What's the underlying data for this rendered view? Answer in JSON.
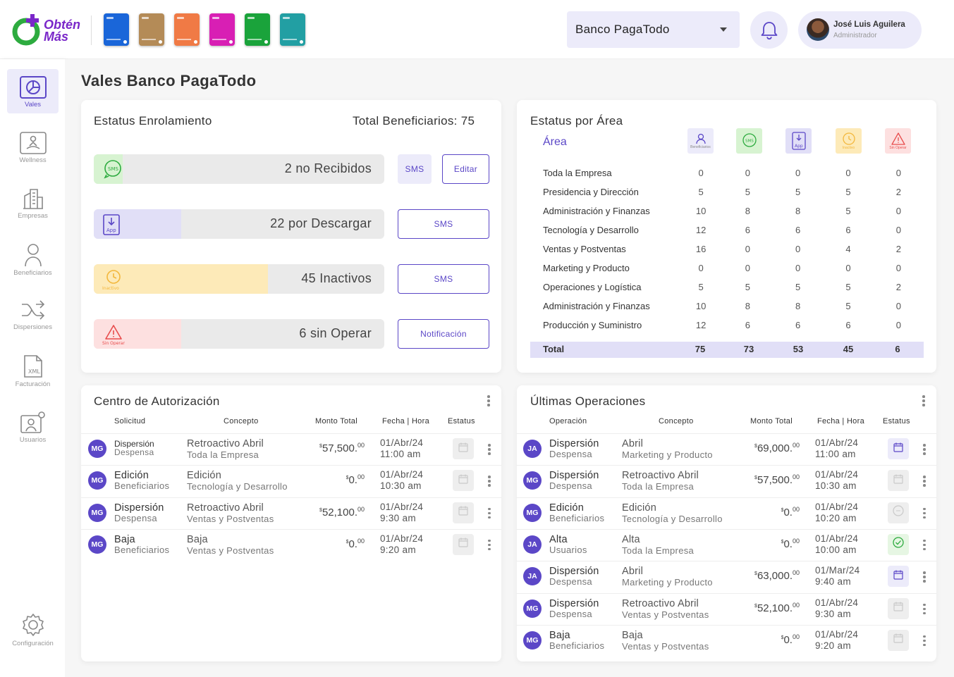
{
  "brand": {
    "line1": "Obtén",
    "line2": "Más"
  },
  "cards": [
    {
      "color": "#1a66d9"
    },
    {
      "color": "#b48b57"
    },
    {
      "color": "#f07a45"
    },
    {
      "color": "#d81fb4"
    },
    {
      "color": "#1aa33b"
    },
    {
      "color": "#229fa3"
    }
  ],
  "company_select": {
    "value": "Banco PagaTodo"
  },
  "user": {
    "name": "José Luis Aguilera",
    "role": "Administrador"
  },
  "sidebar": [
    {
      "label": "Vales",
      "icon": "pie-chart-icon"
    },
    {
      "label": "Wellness",
      "icon": "meditation-icon"
    },
    {
      "label": "Empresas",
      "icon": "building-icon"
    },
    {
      "label": "Beneficiarios",
      "icon": "person-icon"
    },
    {
      "label": "Dispersiones",
      "icon": "shuffle-icon"
    },
    {
      "label": "Facturación",
      "icon": "xml-file-icon"
    },
    {
      "label": "Usuarios",
      "icon": "user-gear-icon"
    },
    {
      "label": "Configuración",
      "icon": "gear-icon"
    }
  ],
  "page_title": "Vales Banco PagaTodo",
  "enrollment": {
    "title": "Estatus Enrolamiento",
    "total_label": "Total Beneficiarios: 75",
    "items": [
      {
        "text": "2 no Recibidos",
        "icon_label": "SMS",
        "progress": 0.1,
        "color": "#d7f3d1",
        "actions": [
          "SMS",
          "Editar"
        ]
      },
      {
        "text": "22 por Descargar",
        "icon_label": "App",
        "progress": 0.3,
        "color": "#e1dff7",
        "actions": [
          "SMS"
        ]
      },
      {
        "text": "45 Inactivos",
        "icon_label": "Inactivo",
        "progress": 0.6,
        "color": "#fdeab8",
        "actions": [
          "SMS"
        ]
      },
      {
        "text": "6 sin Operar",
        "icon_label": "Sin Operar",
        "progress": 0.3,
        "color": "#fde0e0",
        "actions": [
          "Notificación"
        ]
      }
    ]
  },
  "area_status": {
    "title": "Estatus por Área",
    "area_label": "Área",
    "columns": [
      {
        "label": "Beneficiarios",
        "color": "#ecebfa"
      },
      {
        "label": "SMS",
        "color": "#d7f3d1"
      },
      {
        "label": "App",
        "color": "#e1dff7"
      },
      {
        "label": "Inactivo",
        "color": "#fdeab8"
      },
      {
        "label": "Sin Operar",
        "color": "#fde0e0"
      }
    ],
    "rows": [
      {
        "area": "Toda la Empresa",
        "values": [
          "0",
          "0",
          "0",
          "0",
          "0"
        ]
      },
      {
        "area": "Presidencia y Dirección",
        "values": [
          "5",
          "5",
          "5",
          "5",
          "2"
        ]
      },
      {
        "area": "Administración y Finanzas",
        "values": [
          "10",
          "8",
          "8",
          "5",
          "0"
        ]
      },
      {
        "area": "Tecnología y Desarrollo",
        "values": [
          "12",
          "6",
          "6",
          "6",
          "0"
        ]
      },
      {
        "area": "Ventas y Postventas",
        "values": [
          "16",
          "0",
          "0",
          "4",
          "2"
        ]
      },
      {
        "area": "Marketing y Producto",
        "values": [
          "0",
          "0",
          "0",
          "0",
          "0"
        ]
      },
      {
        "area": "Operaciones y Logística",
        "values": [
          "5",
          "5",
          "5",
          "5",
          "2"
        ]
      },
      {
        "area": "Administración y Finanzas",
        "values": [
          "10",
          "8",
          "8",
          "5",
          "0"
        ]
      },
      {
        "area": "Producción y Suministro",
        "values": [
          "12",
          "6",
          "6",
          "6",
          "0"
        ]
      }
    ],
    "total": {
      "label": "Total",
      "values": [
        "75",
        "73",
        "53",
        "45",
        "6"
      ]
    }
  },
  "authorization": {
    "title": "Centro de Autorización",
    "headers": [
      "Solicitud",
      "Concepto",
      "Monto Total",
      "Fecha | Hora",
      "Estatus"
    ],
    "rows": [
      {
        "initials": "MG",
        "type": "Dispersión",
        "sub": "Despensa",
        "concept": "Retroactivo Abril",
        "area": "Toda la Empresa",
        "currency": "$",
        "amount": "57,500.",
        "cents": "00",
        "date": "01/Abr/24",
        "time": "11:00 am",
        "status": "calendar-icon",
        "small": true
      },
      {
        "initials": "MG",
        "type": "Edición",
        "sub": "Beneficiarios",
        "concept": "Edición",
        "area": "Tecnología y Desarrollo",
        "currency": "$",
        "amount": "0.",
        "cents": "00",
        "date": "01/Abr/24",
        "time": "10:30 am",
        "status": "calendar-icon"
      },
      {
        "initials": "MG",
        "type": "Dispersión",
        "sub": "Despensa",
        "concept": "Retroactivo Abril",
        "area": "Ventas y Postventas",
        "currency": "$",
        "amount": "52,100.",
        "cents": "00",
        "date": "01/Abr/24",
        "time": "9:30 am",
        "status": "calendar-icon"
      },
      {
        "initials": "MG",
        "type": "Baja",
        "sub": "Beneficiarios",
        "concept": "Baja",
        "area": "Ventas y Postventas",
        "currency": "$",
        "amount": "0.",
        "cents": "00",
        "date": "01/Abr/24",
        "time": "9:20 am",
        "status": "calendar-icon"
      }
    ]
  },
  "operations": {
    "title": "Últimas Operaciones",
    "headers": [
      "Operación",
      "Concepto",
      "Monto Total",
      "Fecha | Hora",
      "Estatus"
    ],
    "rows": [
      {
        "initials": "JA",
        "type": "Dispersión",
        "sub": "Despensa",
        "concept": "Abril",
        "area": "Marketing y Producto",
        "currency": "$",
        "amount": "69,000.",
        "cents": "00",
        "date": "01/Abr/24",
        "time": "11:00 am",
        "status": "calendar-purple-icon"
      },
      {
        "initials": "MG",
        "type": "Dispersión",
        "sub": "Despensa",
        "concept": "Retroactivo Abril",
        "area": "Toda la Empresa",
        "currency": "$",
        "amount": "57,500.",
        "cents": "00",
        "date": "01/Abr/24",
        "time": "10:30 am",
        "status": "calendar-icon"
      },
      {
        "initials": "MG",
        "type": "Edición",
        "sub": "Beneficiarios",
        "concept": "Edición",
        "area": "Tecnología y Desarrollo",
        "currency": "$",
        "amount": "0.",
        "cents": "00",
        "date": "01/Abr/24",
        "time": "10:20 am",
        "status": "sms-icon"
      },
      {
        "initials": "JA",
        "type": "Alta",
        "sub": "Usuarios",
        "concept": "Alta",
        "area": "Toda la Empresa",
        "currency": "$",
        "amount": "0.",
        "cents": "00",
        "date": "01/Abr/24",
        "time": "10:00 am",
        "status": "check-icon"
      },
      {
        "initials": "JA",
        "type": "Dispersión",
        "sub": "Despensa",
        "concept": "Abril",
        "area": "Marketing y Producto",
        "currency": "$",
        "amount": "63,000.",
        "cents": "00",
        "date": "01/Mar/24",
        "time": "9:40 am",
        "status": "calendar-purple-icon"
      },
      {
        "initials": "MG",
        "type": "Dispersión",
        "sub": "Despensa",
        "concept": "Retroactivo Abril",
        "area": "Ventas y Postventas",
        "currency": "$",
        "amount": "52,100.",
        "cents": "00",
        "date": "01/Abr/24",
        "time": "9:30 am",
        "status": "calendar-icon"
      },
      {
        "initials": "MG",
        "type": "Baja",
        "sub": "Beneficiarios",
        "concept": "Baja",
        "area": "Ventas y Postventas",
        "currency": "$",
        "amount": "0.",
        "cents": "00",
        "date": "01/Abr/24",
        "time": "9:20 am",
        "status": "calendar-icon"
      }
    ]
  }
}
